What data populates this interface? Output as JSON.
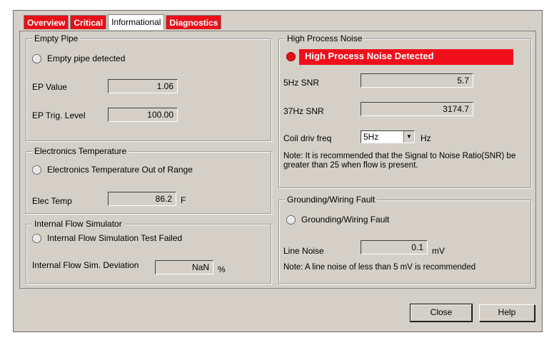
{
  "tabs": [
    {
      "label": "Overview",
      "style": "alert"
    },
    {
      "label": "Critical",
      "style": "alert"
    },
    {
      "label": "Informational",
      "style": "active"
    },
    {
      "label": "Diagnostics",
      "style": "alert"
    }
  ],
  "empty_pipe": {
    "title": "Empty Pipe",
    "indicator_label": "Empty pipe detected",
    "ep_value_label": "EP Value",
    "ep_value": "1.06",
    "ep_trig_label": "EP Trig. Level",
    "ep_trig_value": "100.00"
  },
  "electronics_temperature": {
    "title": "Electronics Temperature",
    "indicator_label": "Electronics Temperature Out of Range",
    "elec_temp_label": "Elec Temp",
    "elec_temp_value": "86.2",
    "elec_temp_unit": "F"
  },
  "internal_flow_simulator": {
    "title": "Internal Flow Simulator",
    "indicator_label": "Internal Flow Simulation Test Failed",
    "deviation_label": "Internal Flow Sim. Deviation",
    "deviation_value": "NaN",
    "deviation_unit": "%"
  },
  "high_process_noise": {
    "title": "High Process Noise",
    "alert_text": "High Process Noise Detected",
    "snr5_label": "5Hz SNR",
    "snr5_value": "5.7",
    "snr37_label": "37Hz SNR",
    "snr37_value": "3174.7",
    "coil_freq_label": "Coil driv freq",
    "coil_freq_value": "5Hz",
    "coil_freq_unit": "Hz",
    "note": "Note: It is recommended that the Signal to Noise Ratio(SNR) be greater than 25 when flow is present."
  },
  "grounding_wiring_fault": {
    "title": "Grounding/Wiring Fault",
    "indicator_label": "Grounding/Wiring Fault",
    "line_noise_label": "Line Noise",
    "line_noise_value": "0.1",
    "line_noise_unit": "mV",
    "note": "Note: A line noise of less than 5 mV is recommended"
  },
  "buttons": {
    "close": "Close",
    "help": "Help"
  },
  "colors": {
    "alert_red": "#e81018",
    "dialog_gray": "#d4d0c8"
  }
}
